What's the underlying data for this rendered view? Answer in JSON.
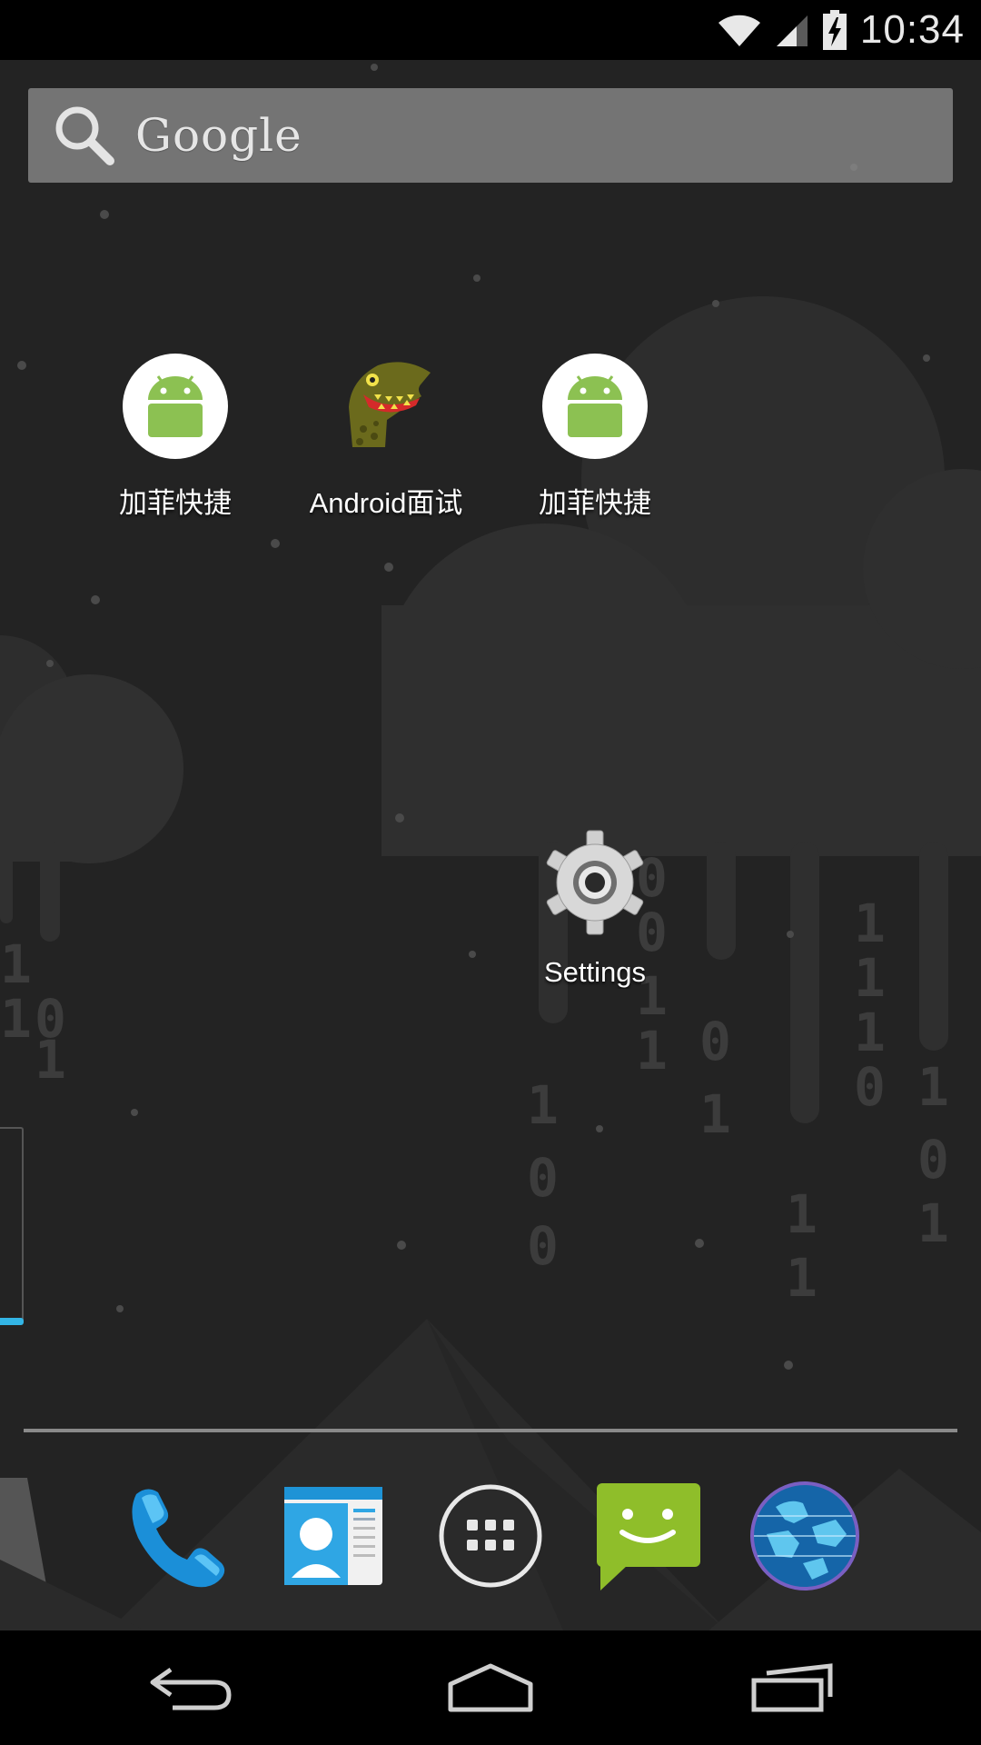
{
  "status_bar": {
    "time": "10:34",
    "icons": [
      "wifi-icon",
      "cell-signal-icon",
      "battery-charging-icon"
    ]
  },
  "search": {
    "brand_text": "Google",
    "icon": "search-icon"
  },
  "home_apps": [
    {
      "label": "加菲快捷",
      "icon": "android-icon"
    },
    {
      "label": "Android面试",
      "icon": "dinosaur-icon"
    },
    {
      "label": "加菲快捷",
      "icon": "android-icon"
    },
    {
      "label": "Settings",
      "icon": "gear-icon"
    }
  ],
  "dock": [
    {
      "name": "Phone",
      "icon": "phone-icon"
    },
    {
      "name": "People",
      "icon": "contacts-icon"
    },
    {
      "name": "Apps",
      "icon": "app-drawer-icon"
    },
    {
      "name": "Messaging",
      "icon": "messaging-icon"
    },
    {
      "name": "Browser",
      "icon": "globe-icon"
    }
  ],
  "nav": [
    "back-icon",
    "home-icon",
    "recents-icon"
  ],
  "colors": {
    "wallpaper": "#232323",
    "cloud": "#333333",
    "android_green": "#8cc152",
    "accent_blue": "#33b5e5",
    "messaging_green": "#8fbe2a"
  }
}
